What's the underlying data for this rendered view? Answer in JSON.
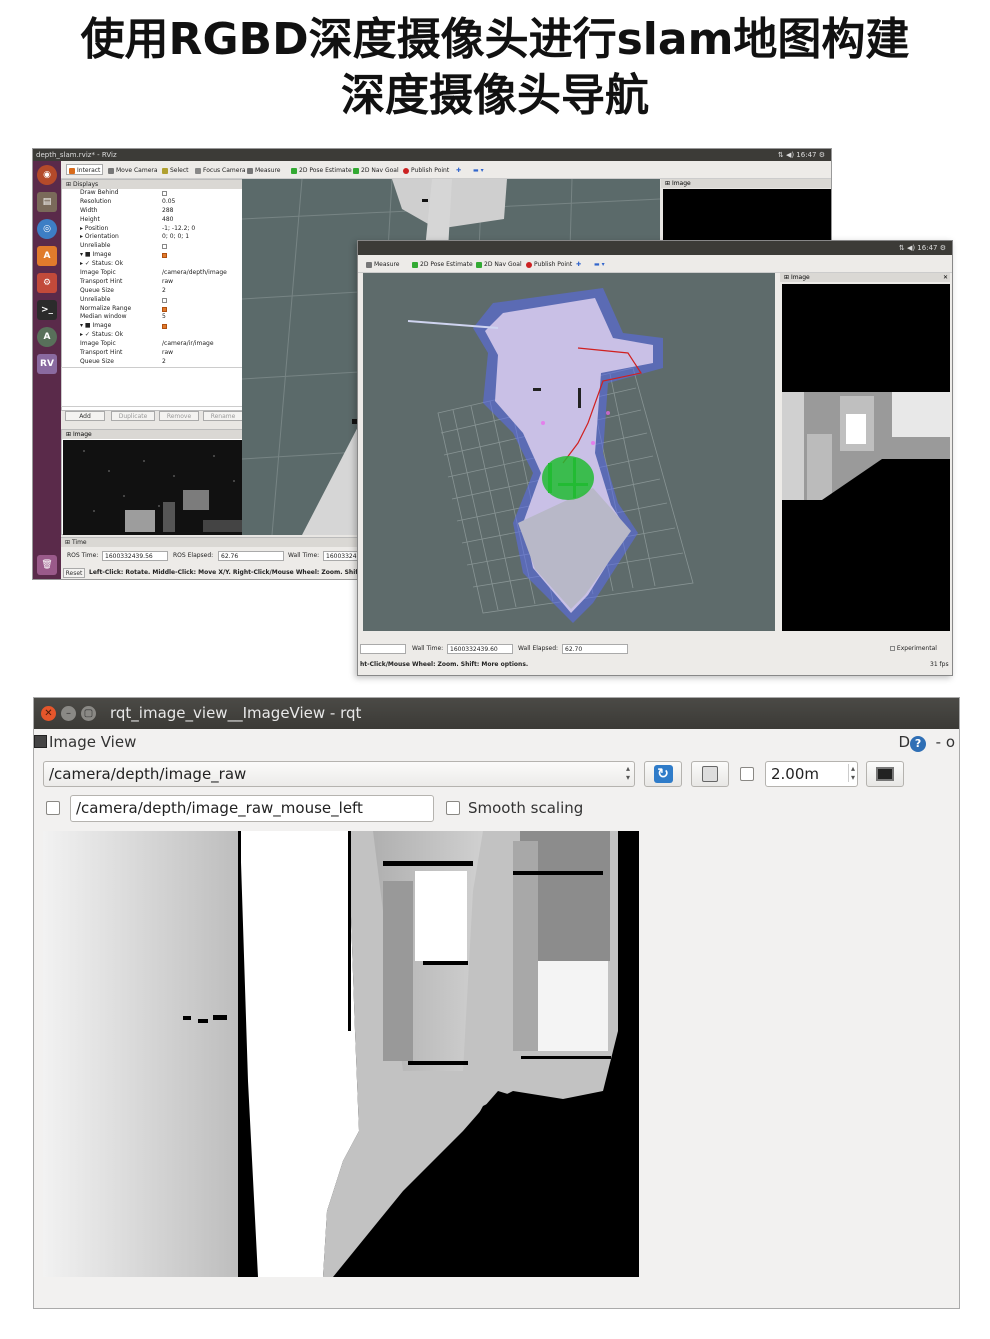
{
  "headline": {
    "line1": "使用RGBD深度摄像头进行slam地图构建",
    "line2": "深度摄像头导航"
  },
  "rviz_back": {
    "window_title": "depth_slam.rviz* - RViz",
    "clock": "16:47",
    "toolbar": [
      "Interact",
      "Move Camera",
      "Select",
      "Focus Camera",
      "Measure",
      "2D Pose Estimate",
      "2D Nav Goal",
      "Publish Point"
    ],
    "displays_title": "Displays",
    "displays_rows": [
      {
        "k": "Draw Behind",
        "v": ""
      },
      {
        "k": "Resolution",
        "v": "0.05"
      },
      {
        "k": "Width",
        "v": "288"
      },
      {
        "k": "Height",
        "v": "480"
      },
      {
        "k": "▸ Position",
        "v": "-1; -12.2; 0"
      },
      {
        "k": "▸ Orientation",
        "v": "0; 0; 0; 1"
      },
      {
        "k": "Unreliable",
        "v": ""
      },
      {
        "k": "▾ ■ Image",
        "v": ""
      },
      {
        "k": "  ▸ ✓ Status: Ok",
        "v": ""
      },
      {
        "k": "Image Topic",
        "v": "/camera/depth/image"
      },
      {
        "k": "Transport Hint",
        "v": "raw"
      },
      {
        "k": "Queue Size",
        "v": "2"
      },
      {
        "k": "Unreliable",
        "v": ""
      },
      {
        "k": "Normalize Range",
        "v": ""
      },
      {
        "k": "Median window",
        "v": "5"
      },
      {
        "k": "▾ ■ Image",
        "v": ""
      },
      {
        "k": "  ▸ ✓ Status: Ok",
        "v": ""
      },
      {
        "k": "Image Topic",
        "v": "/camera/ir/image"
      },
      {
        "k": "Transport Hint",
        "v": "raw"
      },
      {
        "k": "Queue Size",
        "v": "2"
      }
    ],
    "buttons": [
      "Add",
      "Duplicate",
      "Remove",
      "Rename"
    ],
    "image_panel_title": "Image",
    "right_panel_title": "Image",
    "time_title": "Time",
    "ros_time_label": "ROS Time:",
    "ros_time": "1600332439.56",
    "ros_elapsed_label": "ROS Elapsed:",
    "ros_elapsed": "62.76",
    "wall_time_label": "Wall Time:",
    "wall_time": "160033243",
    "reset": "Reset",
    "hint": "Left-Click: Rotate. Middle-Click: Move X/Y. Right-Click/Mouse Wheel: Zoom. Shift: M"
  },
  "rviz_front": {
    "clock": "16:47",
    "toolbar": [
      "Measure",
      "2D Pose Estimate",
      "2D Nav Goal",
      "Publish Point"
    ],
    "image_panel_title": "Image",
    "wall_time_label": "Wall Time:",
    "wall_time": "1600332439.60",
    "wall_elapsed_label": "Wall Elapsed:",
    "wall_elapsed": "62.70",
    "experimental": "Experimental",
    "hint": "ht-Click/Mouse Wheel: Zoom. Shift: More options.",
    "fps": "31 fps"
  },
  "rqt": {
    "window_title": "rqt_image_view__ImageView - rqt",
    "plugin_label": "Image View",
    "help_glyph": "?",
    "d_label": "D",
    "dash_o": "- o",
    "topic_selected": "/camera/depth/image_raw",
    "mouse_topic": "/camera/depth/image_raw_mouse_left",
    "smooth_scaling": "Smooth scaling",
    "max_range": "2.00m"
  },
  "colors": {
    "accent_orange": "#e5562b",
    "map_gray": "#5e6b6b",
    "launcher": "#5a2a4a"
  }
}
